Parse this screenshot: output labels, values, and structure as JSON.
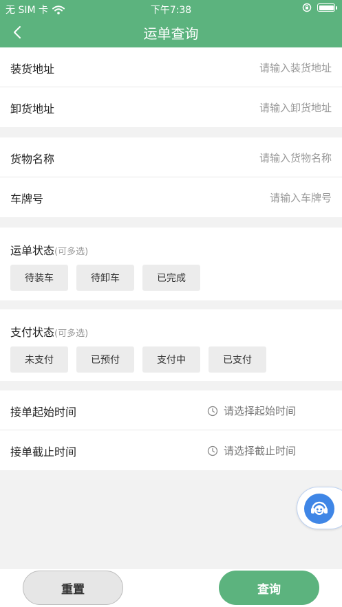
{
  "status_bar": {
    "carrier": "无 SIM 卡",
    "time": "下午7:38"
  },
  "nav": {
    "title": "运单查询"
  },
  "address": {
    "loading": {
      "label": "装货地址",
      "placeholder": "请输入装货地址"
    },
    "unloading": {
      "label": "卸货地址",
      "placeholder": "请输入卸货地址"
    }
  },
  "cargo": {
    "name": {
      "label": "货物名称",
      "placeholder": "请输入货物名称"
    },
    "plate": {
      "label": "车牌号",
      "placeholder": "请输入车牌号"
    }
  },
  "waybill_status": {
    "title": "运单状态",
    "hint": "(可多选)",
    "options": [
      "待装车",
      "待卸车",
      "已完成"
    ]
  },
  "payment_status": {
    "title": "支付状态",
    "hint": "(可多选)",
    "options": [
      "未支付",
      "已预付",
      "支付中",
      "已支付"
    ]
  },
  "time": {
    "start": {
      "label": "接单起始时间",
      "placeholder": "请选择起始时间"
    },
    "end": {
      "label": "接单截止时间",
      "placeholder": "请选择截止时间"
    }
  },
  "buttons": {
    "reset": "重置",
    "query": "查询"
  },
  "colors": {
    "primary": "#5cb37e",
    "assistant": "#3f86e6"
  }
}
